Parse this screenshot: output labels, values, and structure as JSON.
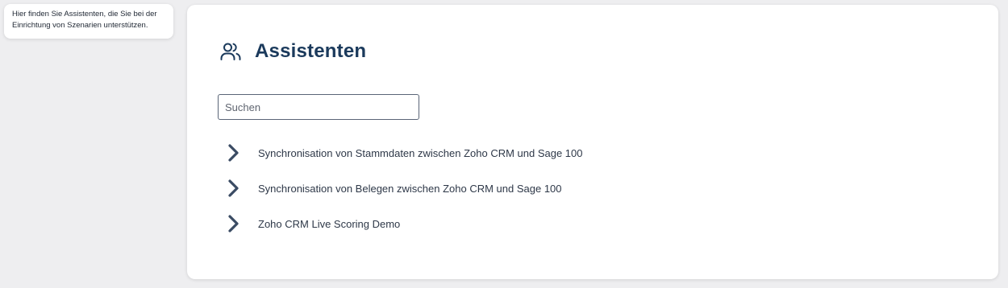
{
  "info": {
    "text": "Hier finden Sie Assistenten, die Sie bei der Einrichtung von Szenarien unterstützen."
  },
  "header": {
    "icon": "users-icon",
    "title": "Assistenten"
  },
  "search": {
    "placeholder": "Suchen",
    "value": ""
  },
  "assistants": {
    "icon": "chevron-right-icon",
    "items": [
      {
        "label": "Synchronisation von Stammdaten zwischen Zoho CRM und Sage 100"
      },
      {
        "label": "Synchronisation von Belegen zwischen Zoho CRM und Sage 100"
      },
      {
        "label": "Zoho CRM Live Scoring Demo"
      }
    ]
  },
  "colors": {
    "title": "#1b3a5c",
    "chevron": "#3a4b63",
    "background": "#eeeef0"
  }
}
